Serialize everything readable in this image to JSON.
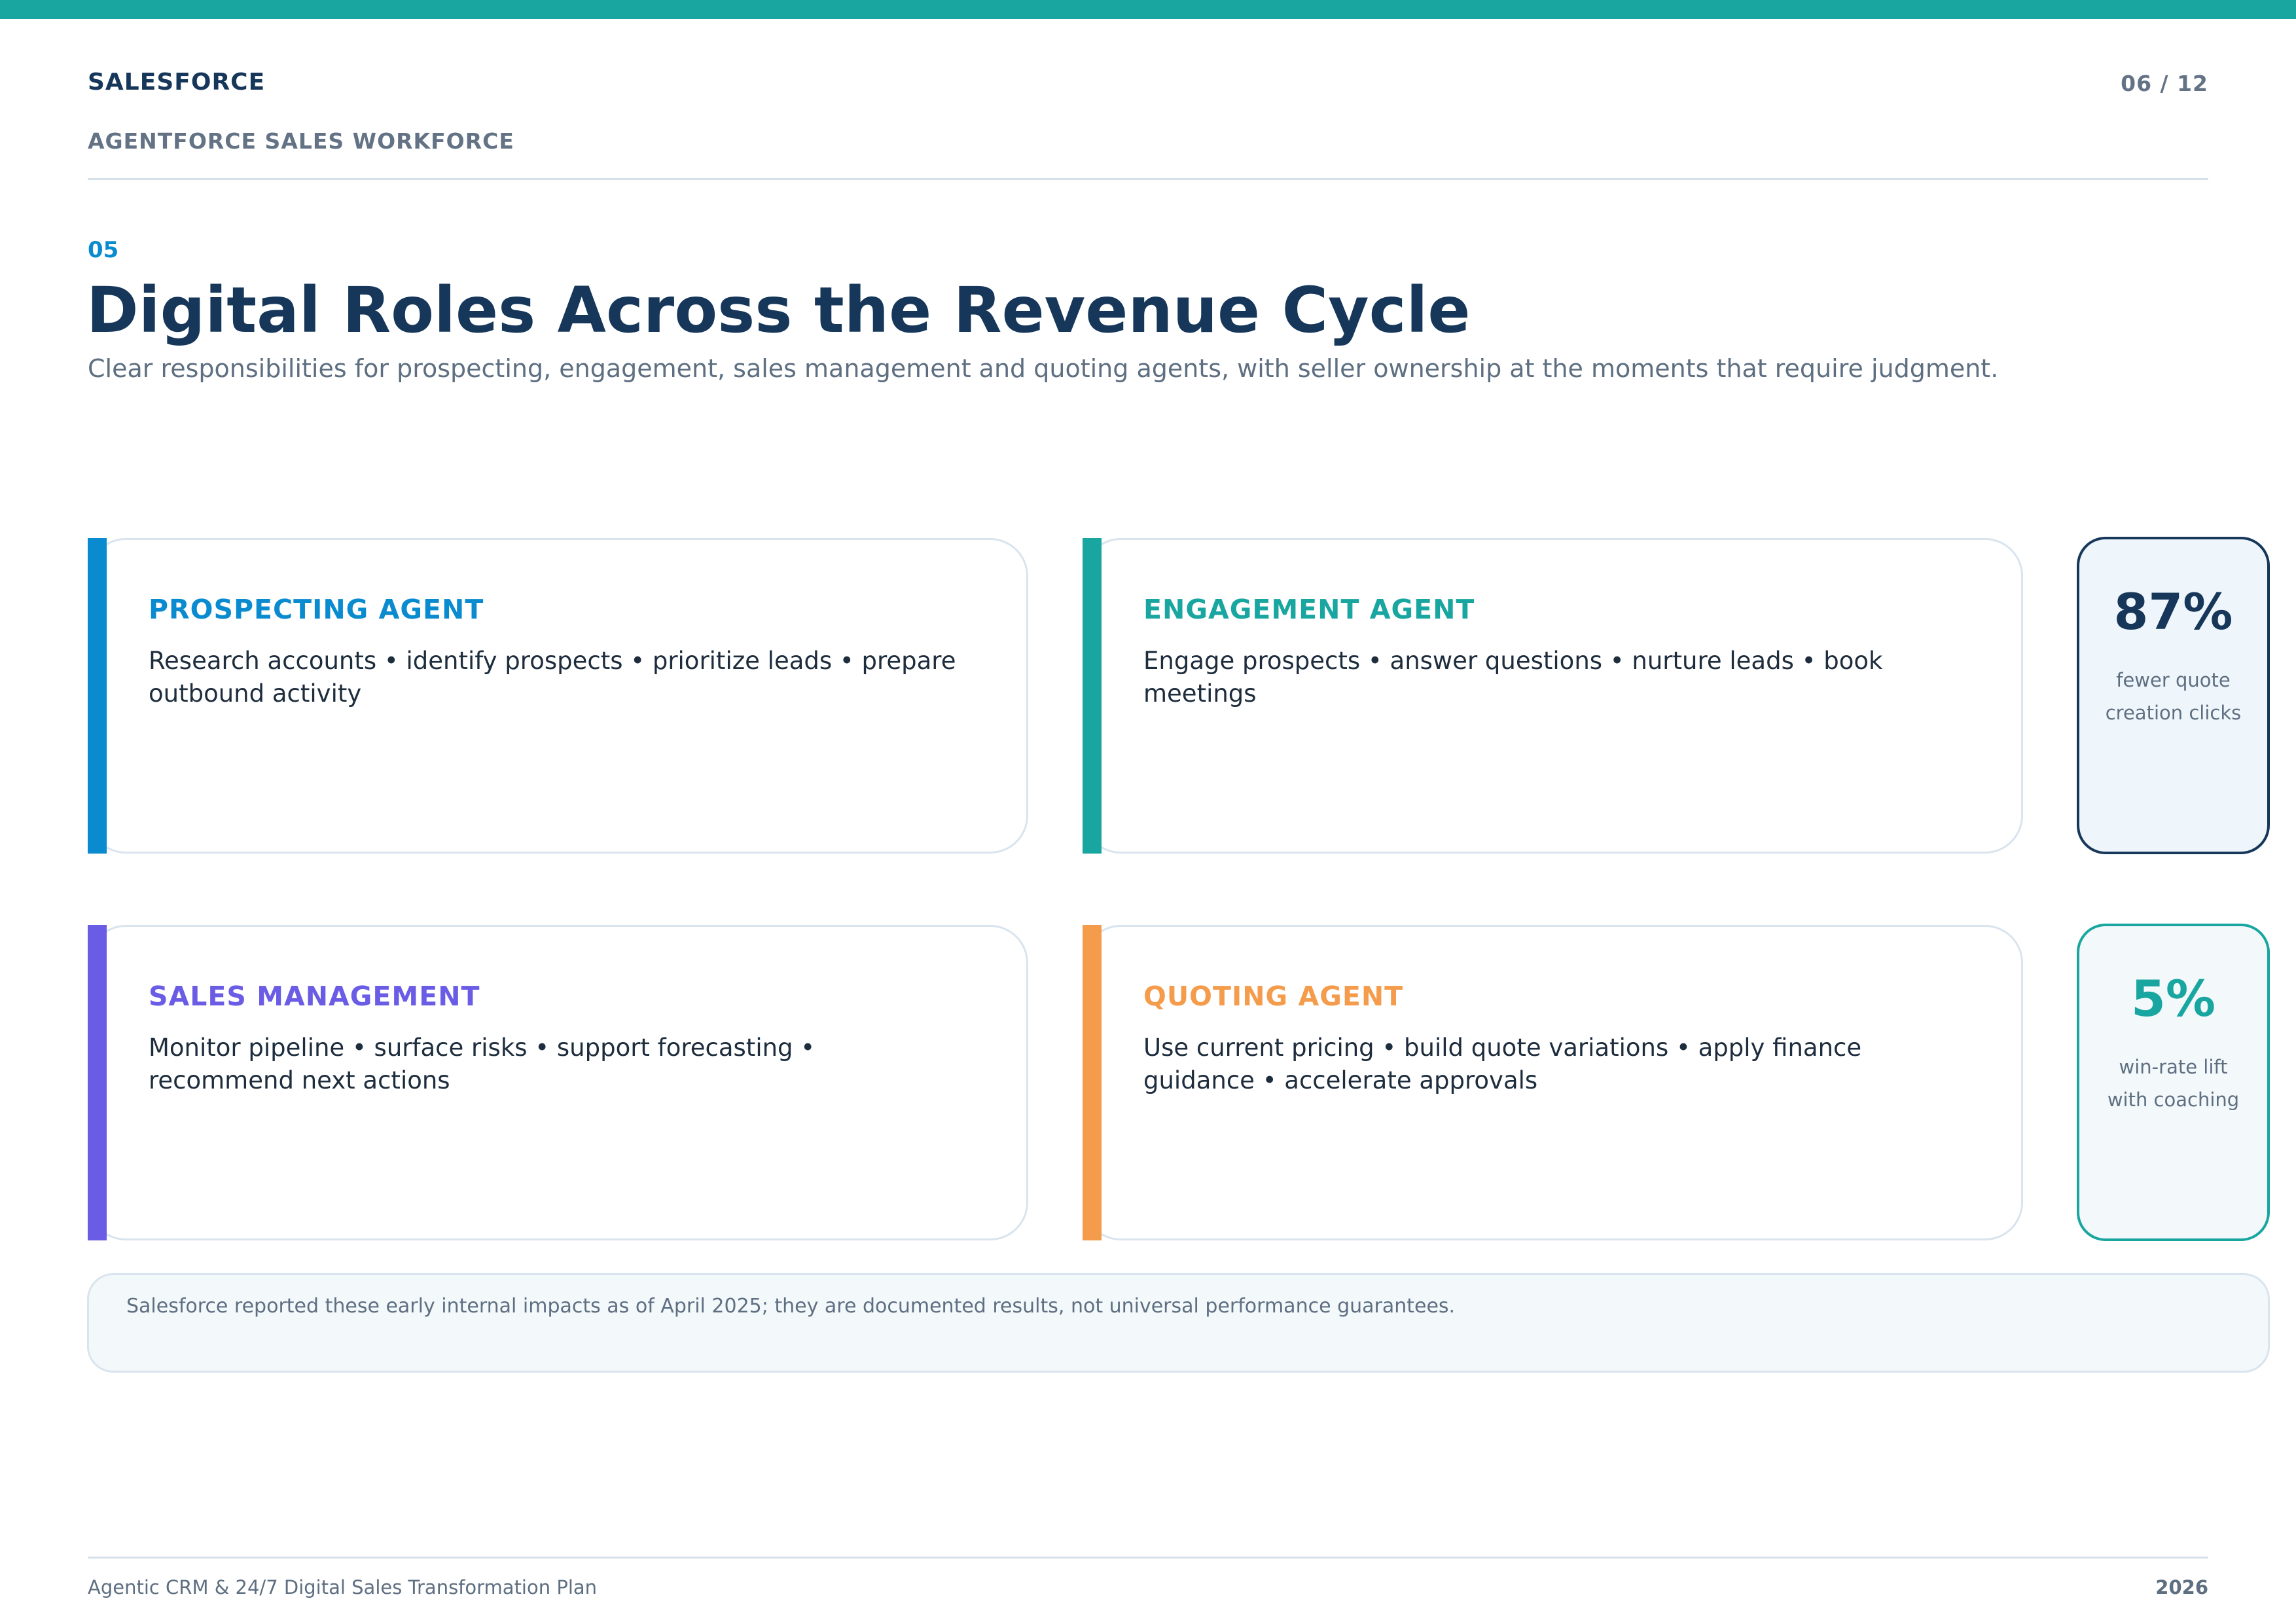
{
  "header": {
    "brand": "SALESFORCE",
    "subbrand": "AGENTFORCE SALES WORKFORCE",
    "page_number": "06 / 12"
  },
  "section": {
    "number": "05",
    "title": "Digital Roles Across the Revenue Cycle",
    "subtitle": "Clear responsibilities for prospecting, engagement, sales management and quoting agents, with seller ownership at the moments that require judgment."
  },
  "cards": [
    {
      "title": "PROSPECTING AGENT",
      "body": "Research accounts • identify prospects • prioritize leads • prepare outbound activity",
      "accent_color": "#0b8bcf"
    },
    {
      "title": "ENGAGEMENT AGENT",
      "body": "Engage prospects • answer questions • nurture leads • book meetings",
      "accent_color": "#1aa6a0"
    },
    {
      "title": "SALES MANAGEMENT",
      "body": "Monitor pipeline • surface risks • support forecasting • recommend next actions",
      "accent_color": "#6b5ce6"
    },
    {
      "title": "QUOTING AGENT",
      "body": "Use current pricing • build quote variations • apply finance guidance • accelerate approvals",
      "accent_color": "#f49c4c"
    }
  ],
  "stats": [
    {
      "value": "87%",
      "label_line1": "fewer quote",
      "label_line2": "creation clicks",
      "color": "#16375a"
    },
    {
      "value": "5%",
      "label_line1": "win-rate lift",
      "label_line2": "with coaching",
      "color": "#1aa6a0"
    }
  ],
  "note": {
    "text": "Salesforce reported these early internal impacts as of April 2025; they are documented results, not universal performance guarantees."
  },
  "footer": {
    "left": "Agentic CRM & 24/7 Digital Sales Transformation Plan",
    "right": "2026"
  }
}
